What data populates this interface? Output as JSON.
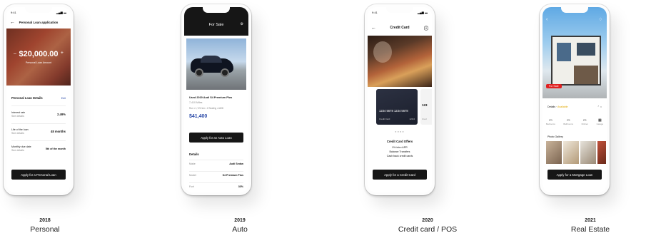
{
  "phones": {
    "personal": {
      "time": "9:41",
      "title": "Personal Loan application",
      "amount": "$20,000.00",
      "amount_label": "Personal Loan Amount",
      "details_heading": "Personal Loan Details",
      "edit": "Edit",
      "rows": [
        {
          "label": "Interest rate",
          "sub": "See details",
          "value": "2.49%"
        },
        {
          "label": "Life of the loan",
          "sub": "See details",
          "value": "48 months"
        },
        {
          "label": "Monthly due date",
          "sub": "See details",
          "value": "5th of the month"
        }
      ],
      "button": "Apply for a Personal Loan"
    },
    "auto": {
      "title": "For Sale",
      "car_name": "Used 2019 Audi S4 Premium Plus",
      "car_sub": "7,410 Miles",
      "car_meta": "Run • 1,722 km • 2 Seating • AWD",
      "price": "$41,400",
      "button": "Apply for an Auto Loan",
      "details_heading": "Details",
      "rows": [
        {
          "label": "Make",
          "value": "Audi Sedan"
        },
        {
          "label": "Model",
          "value": "S4 Premium Plus"
        },
        {
          "label": "Fuel",
          "value": "33%"
        }
      ]
    },
    "credit": {
      "time": "9:41",
      "title": "Credit Card",
      "card_number": "1234 5678 1234 5678",
      "card_label": "Credit Card",
      "card_expiry": "12/24",
      "card_peek": "123",
      "card_peek_label": "Cred",
      "offers_heading": "Credit Card Offers",
      "offers": [
        "0% intro APR",
        "Balance Transfers",
        "Cash back credit cards"
      ],
      "button": "Apply for a Credit Card"
    },
    "estate": {
      "badge": "For Sale",
      "price_label": "Details",
      "price_sub": "Available",
      "amenities": [
        "Bedrooms",
        "Bathrooms",
        "Kitchen",
        "Garage"
      ],
      "gallery_label": "Photo Gallery",
      "button": "Apply for a Mortgage Loan"
    }
  },
  "captions": [
    {
      "year": "2018",
      "label": "Personal"
    },
    {
      "year": "2019",
      "label": "Auto"
    },
    {
      "year": "2020",
      "label": "Credit card / POS"
    },
    {
      "year": "2021",
      "label": "Real Estate"
    }
  ],
  "colors": {
    "dark": "#161616",
    "accent_blue": "#2b4aa8",
    "badge_red": "#e02020",
    "gold": "#e0a800"
  }
}
